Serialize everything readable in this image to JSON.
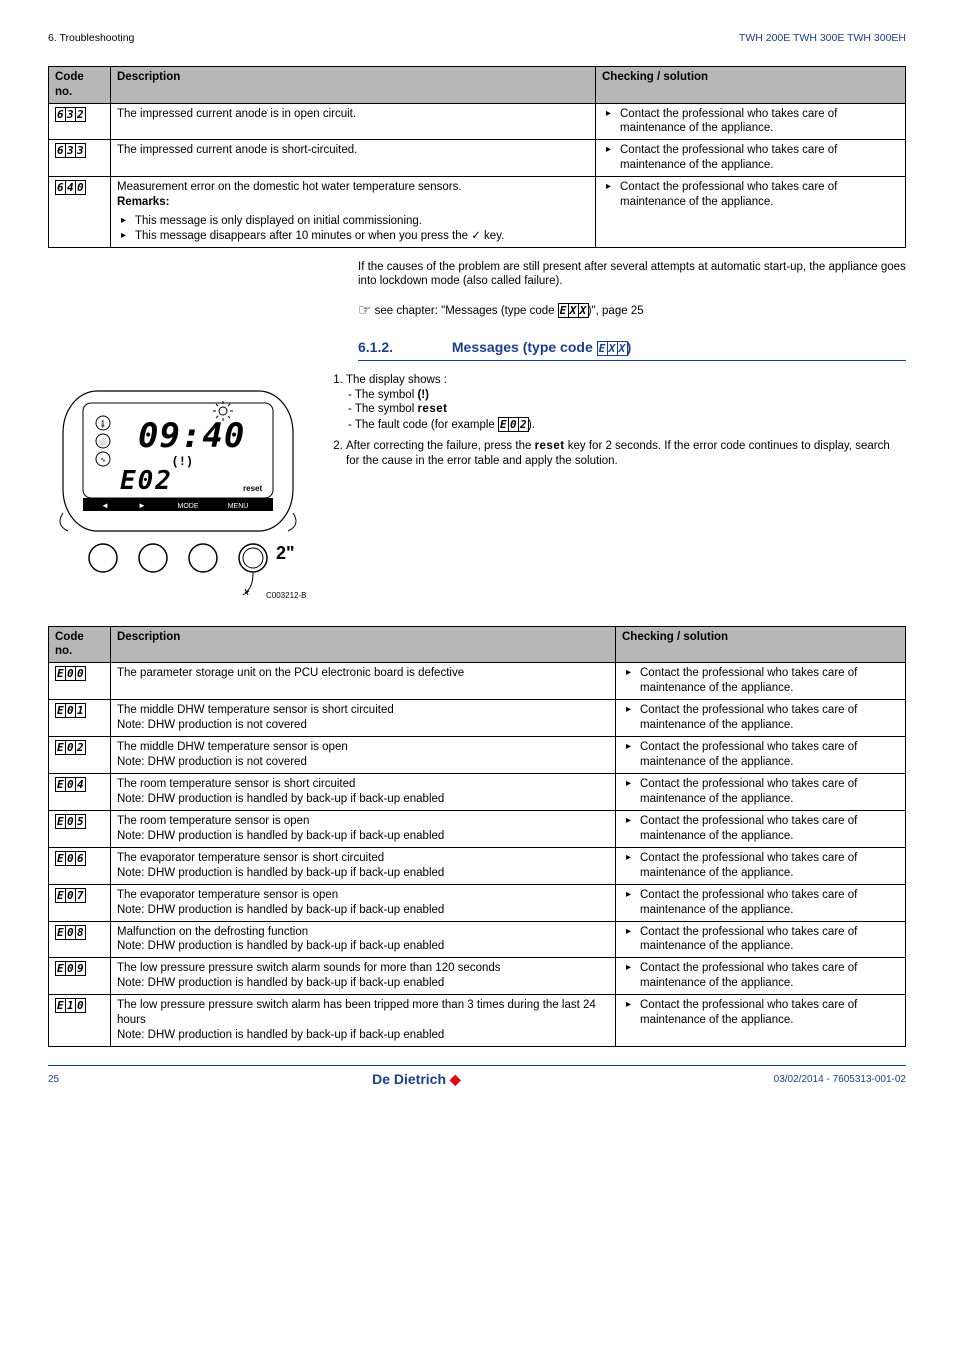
{
  "header": {
    "left": "6.  Troubleshooting",
    "right": "TWH 200E TWH 300E TWH 300EH"
  },
  "tableHeaders": {
    "code": "Code no.",
    "desc": "Description",
    "check": "Checking / solution"
  },
  "generic_solution": "Contact the professional who takes care of maintenance of the appliance.",
  "table1": [
    {
      "code": [
        "6",
        "3",
        "2"
      ],
      "desc": "The impressed current anode is in open circuit."
    },
    {
      "code": [
        "6",
        "3",
        "3"
      ],
      "desc": "The impressed current anode is short-circuited."
    },
    {
      "code": [
        "6",
        "4",
        "0"
      ],
      "desc_main": "Measurement error on the domestic hot water temperature sensors.",
      "remarks_label": "Remarks:",
      "remarks": [
        "This message is only displayed on initial commissioning.",
        "This message disappears after 10 minutes or when you press the ✓ key."
      ]
    }
  ],
  "midtext": {
    "p1": "If the causes of the problem are still present after several attempts at automatic start-up, the appliance goes into lockdown mode (also called failure).",
    "see_pre": "see chapter:  \"Messages (type code ",
    "see_post": ")\", page 25"
  },
  "section612": {
    "num": "6.1.2.",
    "title_pre": "Messages (type code ",
    "title_post": ")"
  },
  "displayList": {
    "l1": "The display shows :",
    "s1": "- The symbol ",
    "s1b": "(!)",
    "s2": "- The symbol ",
    "s2b": "reset",
    "s3": "- The fault code (for example ",
    "s3b": ").",
    "l2a": "After correcting the failure, press the ",
    "l2key": "reset",
    "l2b": " key for 2 seconds. If the error code continues to display, search for the cause in the error table and apply the solution."
  },
  "diagram": {
    "two_sec": "2\"",
    "code_label": "C003212-B",
    "reset": "reset",
    "mode": "MODE",
    "menu": "MENU",
    "left": "◄",
    "right": "►"
  },
  "table2": [
    {
      "code": [
        "E",
        "0",
        "0"
      ],
      "desc": "The parameter storage unit on the PCU electronic board is defective"
    },
    {
      "code": [
        "E",
        "0",
        "1"
      ],
      "desc": "The middle DHW temperature sensor is short circuited\nNote: DHW production is not covered"
    },
    {
      "code": [
        "E",
        "0",
        "2"
      ],
      "desc": "The middle DHW temperature sensor is open\nNote: DHW production is not covered"
    },
    {
      "code": [
        "E",
        "0",
        "4"
      ],
      "desc": "The room temperature sensor is short circuited\nNote: DHW production is handled by back-up if back-up enabled"
    },
    {
      "code": [
        "E",
        "0",
        "5"
      ],
      "desc": "The room temperature sensor is open\nNote: DHW production is handled by back-up if back-up enabled"
    },
    {
      "code": [
        "E",
        "0",
        "6"
      ],
      "desc": "The evaporator temperature sensor is short circuited\nNote: DHW production is handled by back-up if back-up enabled"
    },
    {
      "code": [
        "E",
        "0",
        "7"
      ],
      "desc": "The evaporator temperature sensor is open\nNote: DHW production is handled by back-up if back-up enabled"
    },
    {
      "code": [
        "E",
        "0",
        "8"
      ],
      "desc": "Malfunction on the defrosting function\nNote: DHW production is handled by back-up if back-up enabled"
    },
    {
      "code": [
        "E",
        "0",
        "9"
      ],
      "desc": "The low pressure pressure switch alarm sounds for more than 120 seconds\nNote: DHW production is handled by back-up if back-up enabled"
    },
    {
      "code": [
        "E",
        "1",
        "0"
      ],
      "desc": "The low pressure pressure switch alarm has been tripped more than 3 times during the last 24 hours\nNote: DHW production is handled by back-up if back-up enabled"
    }
  ],
  "footer": {
    "page": "25",
    "docnum": "03/02/2014 - 7605313-001-02",
    "brand": "De Dietrich"
  }
}
